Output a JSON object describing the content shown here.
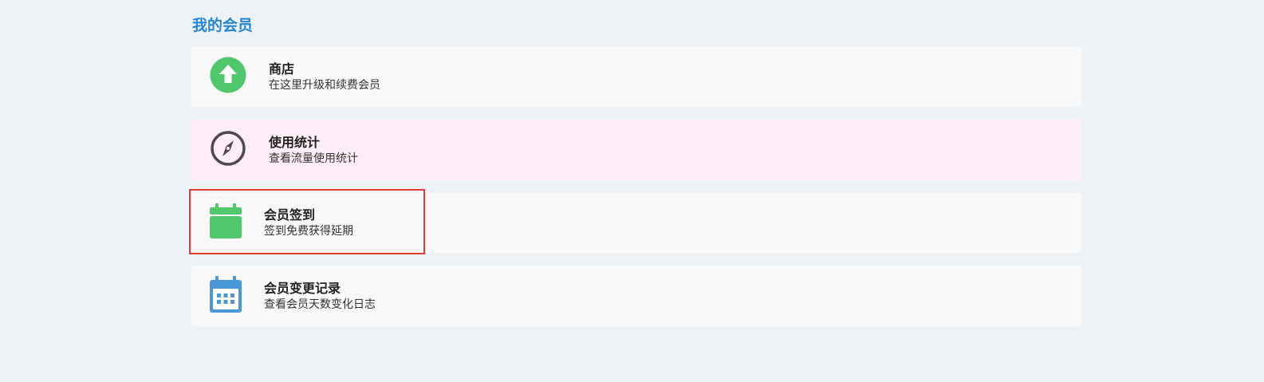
{
  "page": {
    "title": "我的会员"
  },
  "cards": [
    {
      "title": "商店",
      "desc": "在这里升级和续费会员",
      "icon": "arrow-up-circle-icon",
      "color": "#4fc86b"
    },
    {
      "title": "使用统计",
      "desc": "查看流量使用统计",
      "icon": "compass-icon",
      "color": "#4e4950"
    },
    {
      "title": "会员签到",
      "desc": "签到免费获得延期",
      "icon": "calendar-icon",
      "color": "#4fc86b"
    },
    {
      "title": "会员变更记录",
      "desc": "查看会员天数变化日志",
      "icon": "calendar-grid-icon",
      "color": "#4a98d8"
    }
  ],
  "colors": {
    "page_bg": "#edf2f6",
    "card_bg": "#f8f8f8",
    "card_highlight_bg": "#ffeef7",
    "title": "#2586d3",
    "selection_outline": "#e53935"
  }
}
